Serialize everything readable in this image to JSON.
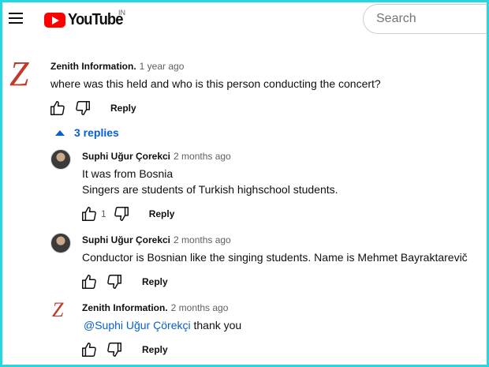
{
  "header": {
    "logo_text": "YouTube",
    "region": "IN",
    "search_placeholder": "Search"
  },
  "colors": {
    "accent": "#065fd4",
    "logo_red": "#ff0000",
    "frame": "#26d6e0",
    "avatar_z": "#c0392b"
  },
  "comment": {
    "avatar_letter": "Z",
    "author": "Zenith Information.",
    "time": "1 year ago",
    "text": "where was this held and who is this person conducting the concert?",
    "reply_label": "Reply"
  },
  "replies_toggle": "3 replies",
  "replies": [
    {
      "author": "Suphi Uğur Çorekci",
      "time": "2 months ago",
      "lines": [
        "It was from Bosnia",
        "Singers are students of Turkish highschool students."
      ],
      "likes": "1",
      "reply_label": "Reply"
    },
    {
      "author": "Suphi Uğur Çorekci",
      "time": "2 months ago",
      "lines": [
        "Conductor is Bosnian like the singing students. Name is Mehmet Bayraktarevič"
      ],
      "reply_label": "Reply"
    },
    {
      "avatar_letter": "Z",
      "author": "Zenith Information.",
      "time": "2 months ago",
      "mention": "@Suphi Uğur Çörekçi",
      "text_after": " thank you",
      "reply_label": "Reply"
    }
  ]
}
